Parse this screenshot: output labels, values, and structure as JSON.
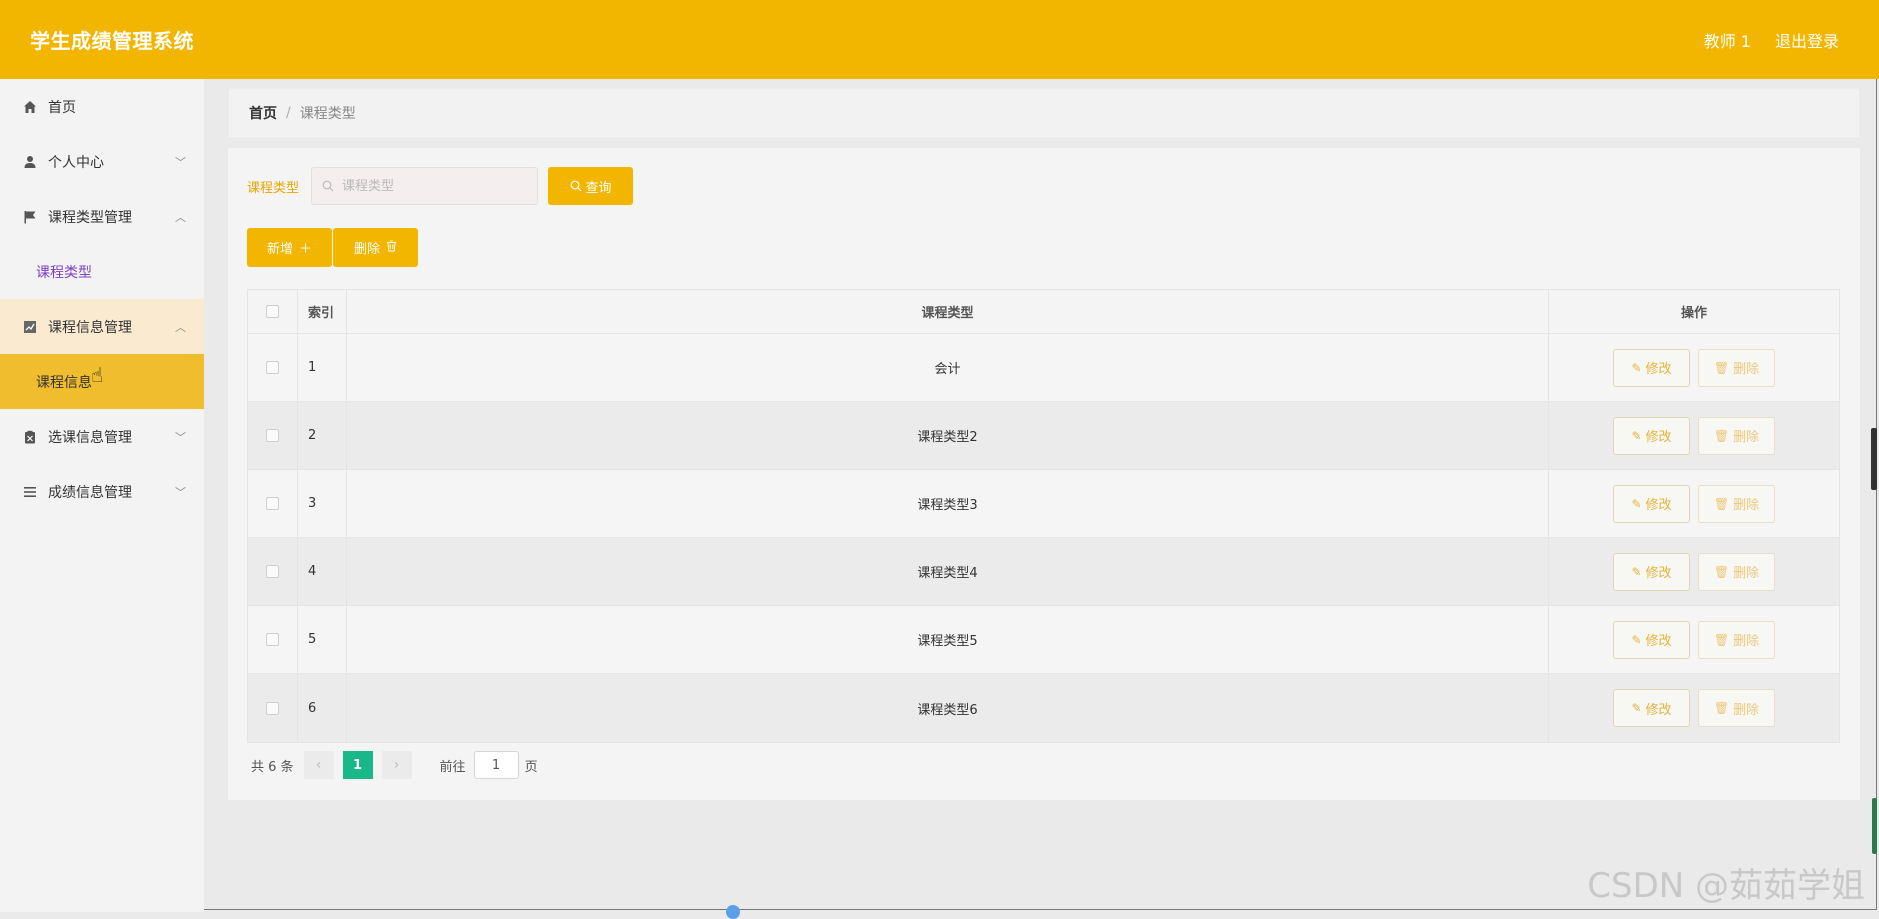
{
  "header": {
    "title": "学生成绩管理系统",
    "user": "教师 1",
    "logout": "退出登录"
  },
  "sidebar": {
    "items": [
      {
        "label": "首页",
        "icon": "home-icon"
      },
      {
        "label": "个人中心",
        "icon": "user-icon"
      },
      {
        "label": "课程类型管理",
        "icon": "flag-icon",
        "sub": "课程类型"
      },
      {
        "label": "课程信息管理",
        "icon": "chart-icon",
        "sub": "课程信息"
      },
      {
        "label": "选课信息管理",
        "icon": "clipboard-icon"
      },
      {
        "label": "成绩信息管理",
        "icon": "list-icon"
      }
    ]
  },
  "breadcrumb": {
    "home": "首页",
    "sep": "/",
    "current": "课程类型"
  },
  "search": {
    "label": "课程类型",
    "placeholder": "课程类型",
    "query_label": "查询"
  },
  "actions": {
    "add_label": "新增",
    "delete_label": "删除"
  },
  "table": {
    "headers": {
      "index": "索引",
      "type": "课程类型",
      "ops": "操作"
    },
    "rows": [
      {
        "index": "1",
        "type": "会计"
      },
      {
        "index": "2",
        "type": "课程类型2"
      },
      {
        "index": "3",
        "type": "课程类型3"
      },
      {
        "index": "4",
        "type": "课程类型4"
      },
      {
        "index": "5",
        "type": "课程类型5"
      },
      {
        "index": "6",
        "type": "课程类型6"
      }
    ],
    "edit_label": "修改",
    "remove_label": "删除"
  },
  "pagination": {
    "total": "共 6 条",
    "current_page": "1",
    "goto_label": "前往",
    "goto_value": "1",
    "page_unit": "页"
  },
  "watermark": "CSDN @茹茹学姐",
  "colors": {
    "primary": "#f2b500",
    "active_menu": "#f0bd2e",
    "pager_active": "#18b888",
    "submenu_text": "#7f3fbf"
  }
}
